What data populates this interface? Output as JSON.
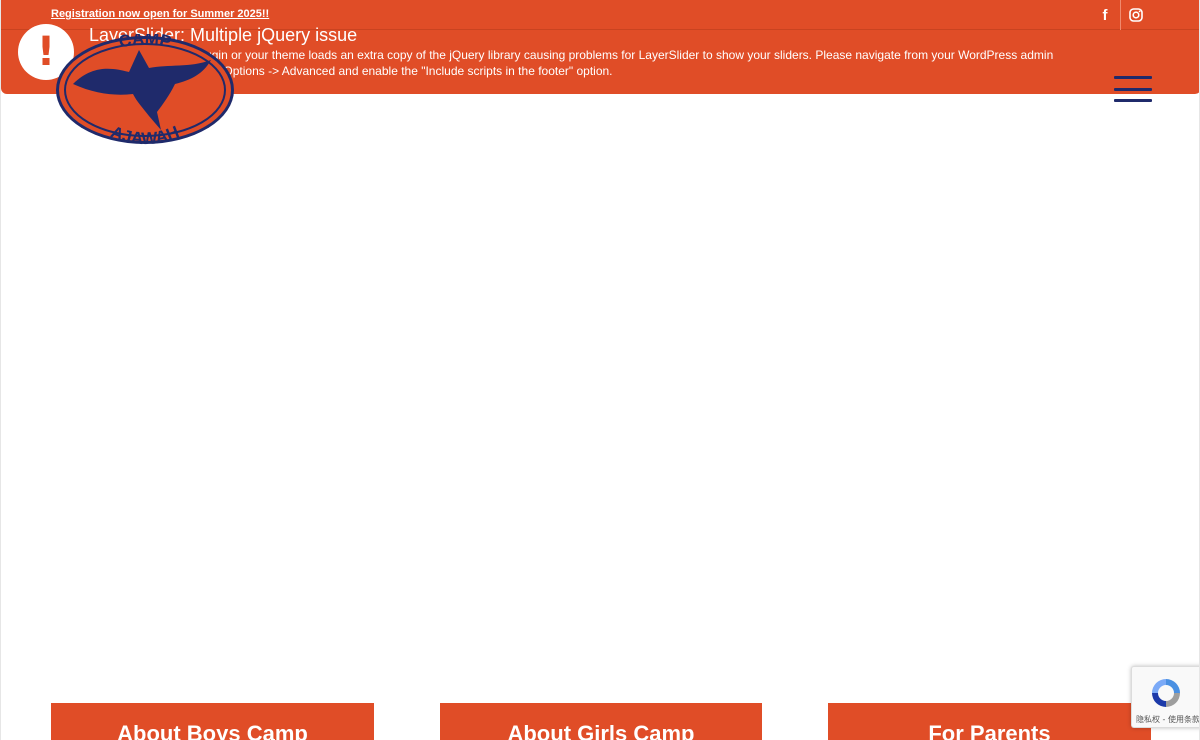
{
  "topbar": {
    "registration_link": "Registration now open for Summer 2025!!",
    "social": [
      {
        "icon": "facebook-icon",
        "glyph": "f"
      },
      {
        "icon": "instagram-icon",
        "glyph": ""
      }
    ]
  },
  "notice": {
    "icon": "exclamation-icon",
    "title": "LayerSlider: Multiple jQuery issue",
    "line1": "It looks like another plugin or your theme loads an extra copy of the jQuery library causing problems for LayerSlider to show your sliders. Please navigate from your WordPress admin",
    "line2": "sidebar to LayerSlider -> Options -> Advanced and enable the \"Include scripts in the footer\" option."
  },
  "logo": {
    "top_text": "CAMP",
    "bottom_text": "AJAWAH"
  },
  "nav": {
    "menu_icon": "hamburger-menu-icon"
  },
  "cards": [
    {
      "title": "About Boys Camp"
    },
    {
      "title": "About Girls Camp"
    },
    {
      "title": "For Parents"
    }
  ],
  "recaptcha": {
    "icon": "recaptcha-icon",
    "text": "隐私权 - 使用条款"
  },
  "colors": {
    "brand_orange": "#e04d27",
    "logo_navy": "#1f2a6b",
    "white": "#ffffff"
  }
}
